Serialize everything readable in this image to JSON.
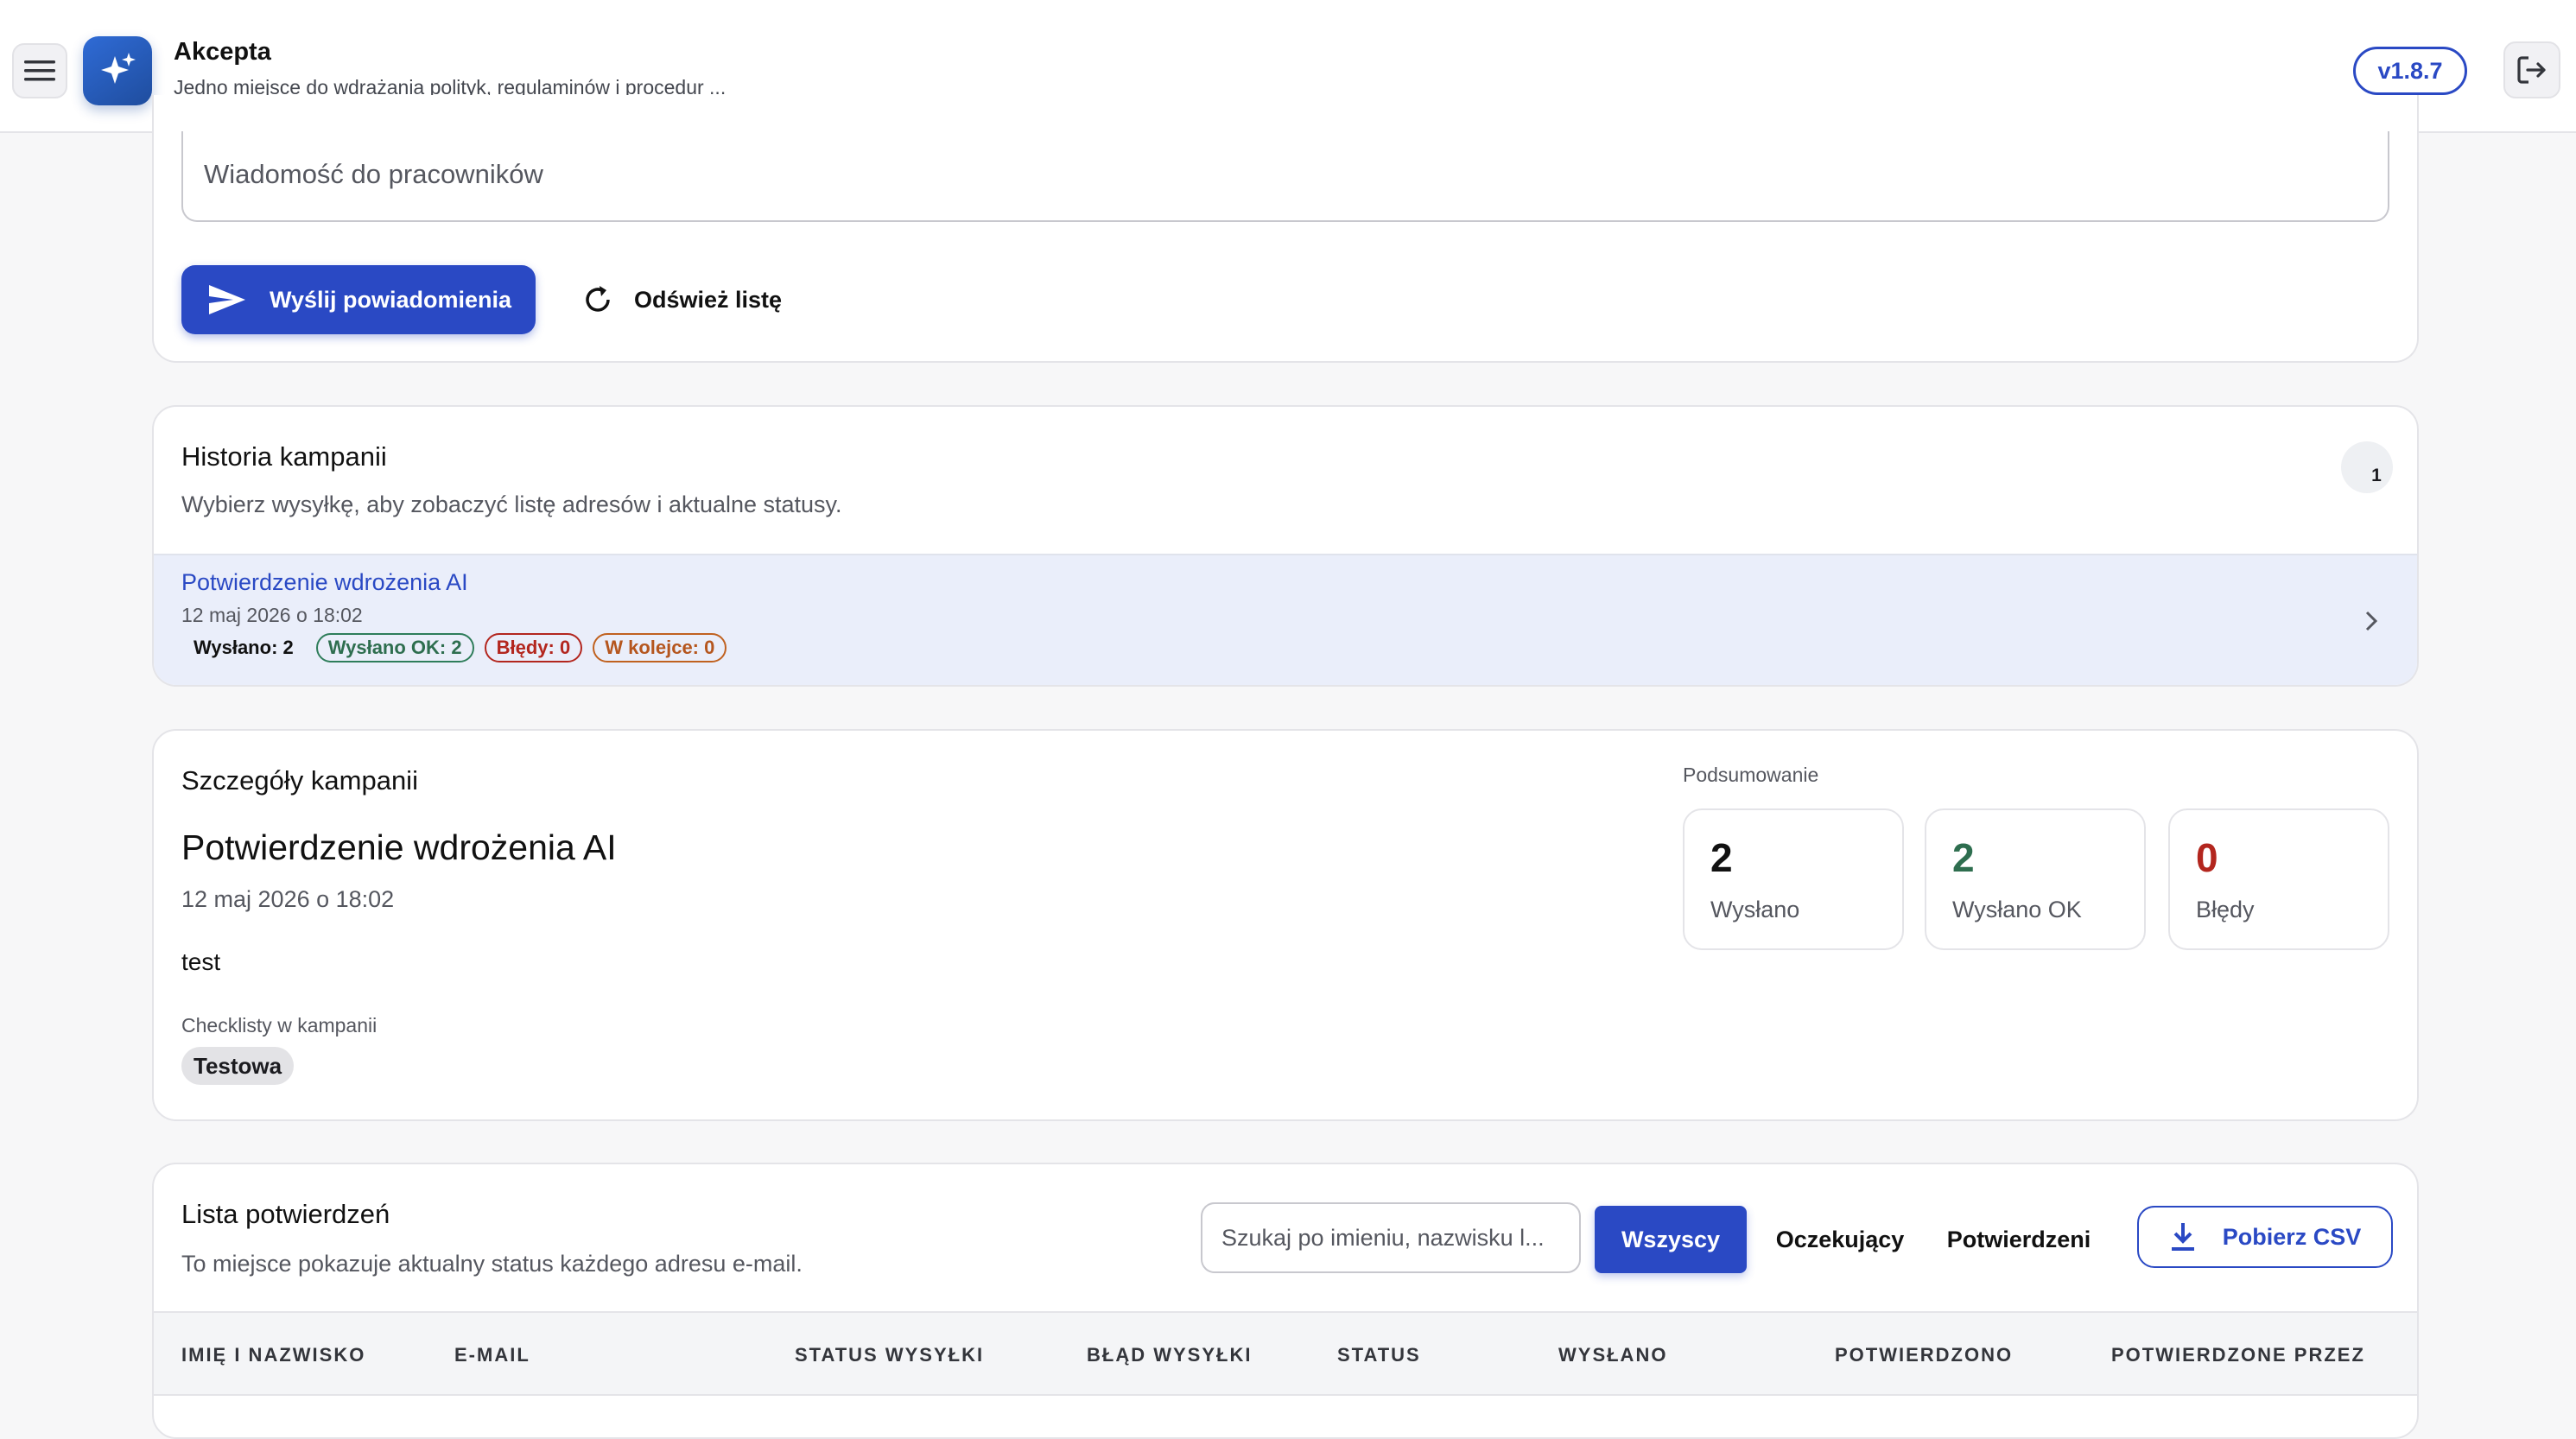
{
  "header": {
    "app_name": "Akcepta",
    "tagline": "Jedno miejsce do wdrażania polityk, regulaminów i procedur ...",
    "version": "v1.8.7",
    "icons": {
      "menu": "menu-icon",
      "logo": "sparkle-icon",
      "logout": "logout-icon"
    }
  },
  "compose": {
    "message_placeholder": "Wiadomość do pracowników",
    "send_label": "Wyślij powiadomienia",
    "refresh_label": "Odśwież listę"
  },
  "history": {
    "title": "Historia kampanii",
    "subtitle": "Wybierz wysyłkę, aby zobaczyć listę adresów i aktualne statusy.",
    "count": "1",
    "campaigns": [
      {
        "title": "Potwierdzenie wdrożenia AI",
        "date": "12 maj 2026 o 18:02",
        "sent": "Wysłano: 2",
        "sent_ok": "Wysłano OK: 2",
        "errors": "Błędy: 0",
        "queued": "W kolejce: 0"
      }
    ]
  },
  "details": {
    "title": "Szczegóły kampanii",
    "campaign_name": "Potwierdzenie wdrożenia AI",
    "date": "12 maj 2026 o 18:02",
    "message": "test",
    "checklists_label": "Checklisty w kampanii",
    "checklists": [
      "Testowa"
    ],
    "summary_label": "Podsumowanie",
    "stats": [
      {
        "value": "2",
        "label": "Wysłano",
        "color": "#111111"
      },
      {
        "value": "2",
        "label": "Wysłano OK",
        "color": "#2e6e4f"
      },
      {
        "value": "0",
        "label": "Błędy",
        "color": "#b3261e"
      }
    ]
  },
  "confirmations": {
    "title": "Lista potwierdzeń",
    "subtitle": "To miejsce pokazuje aktualny status każdego adresu e-mail.",
    "search_placeholder": "Szukaj po imieniu, nazwisku l...",
    "filters": [
      "Wszyscy",
      "Oczekujący",
      "Potwierdzeni"
    ],
    "active_filter": "Wszyscy",
    "csv_label": "Pobierz CSV",
    "columns": [
      "IMIĘ I NAZWISKO",
      "E-MAIL",
      "STATUS WYSYŁKI",
      "BŁĄD WYSYŁKI",
      "STATUS",
      "WYSŁANO",
      "POTWIERDZONO",
      "POTWIERDZONE PRZEZ"
    ]
  },
  "colors": {
    "accent": "#2a49c4",
    "success": "#2e6e4f",
    "error": "#b3261e",
    "warning": "#c0611f"
  }
}
